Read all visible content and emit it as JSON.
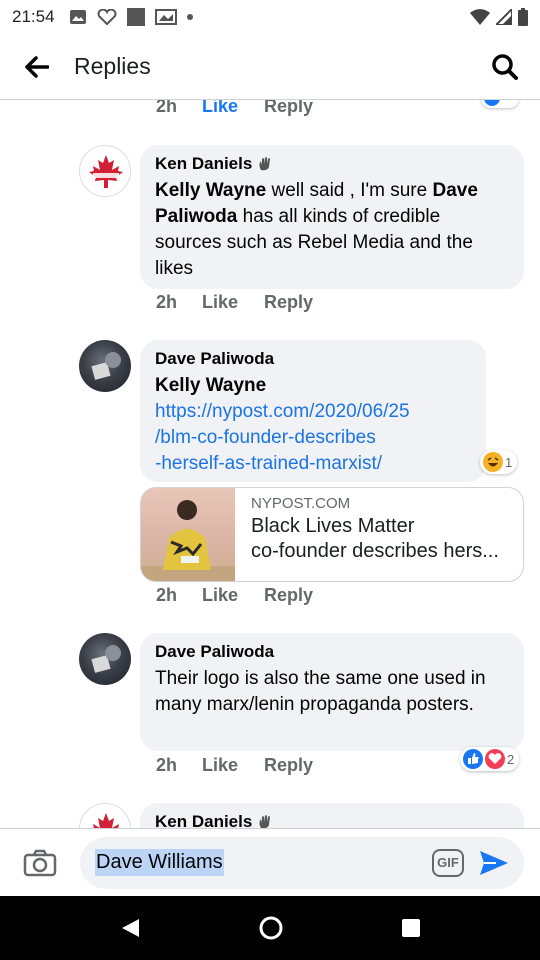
{
  "status_bar": {
    "time": "21:54"
  },
  "app_bar": {
    "title": "Replies"
  },
  "top_actions": {
    "time": "2h",
    "like": "Like",
    "reply": "Reply"
  },
  "comments": [
    {
      "author": "Ken Daniels",
      "text_parts": [
        "Kelly Wayne",
        " well said , I'm sure ",
        "Dave Paliwoda",
        " has all kinds of credible sources such as Rebel Media and the likes"
      ],
      "time": "2h",
      "like": "Like",
      "reply": "Reply"
    },
    {
      "author": "Dave Paliwoda",
      "mention": "Kelly Wayne",
      "link_lines": [
        "https://nypost.com/2020/06/25",
        "/blm-co-founder-describes",
        "-herself-as-trained-marxist/"
      ],
      "reaction_count": "1",
      "preview": {
        "domain": "NYPOST.COM",
        "title_line1": "Black Lives Matter",
        "title_line2": "co-founder describes hers..."
      },
      "time": "2h",
      "like": "Like",
      "reply": "Reply"
    },
    {
      "author": "Dave Paliwoda",
      "text": "Their logo is also the same one used in many marx/lenin propaganda posters.",
      "reaction_count": "2",
      "time": "2h",
      "like": "Like",
      "reply": "Reply"
    },
    {
      "author": "Ken Daniels"
    }
  ],
  "composer": {
    "input_value": "Dave Williams",
    "gif_label": "GIF"
  },
  "colors": {
    "accent": "#1877f2",
    "bubble": "#f0f2f5",
    "secondary_text": "#65676b"
  }
}
